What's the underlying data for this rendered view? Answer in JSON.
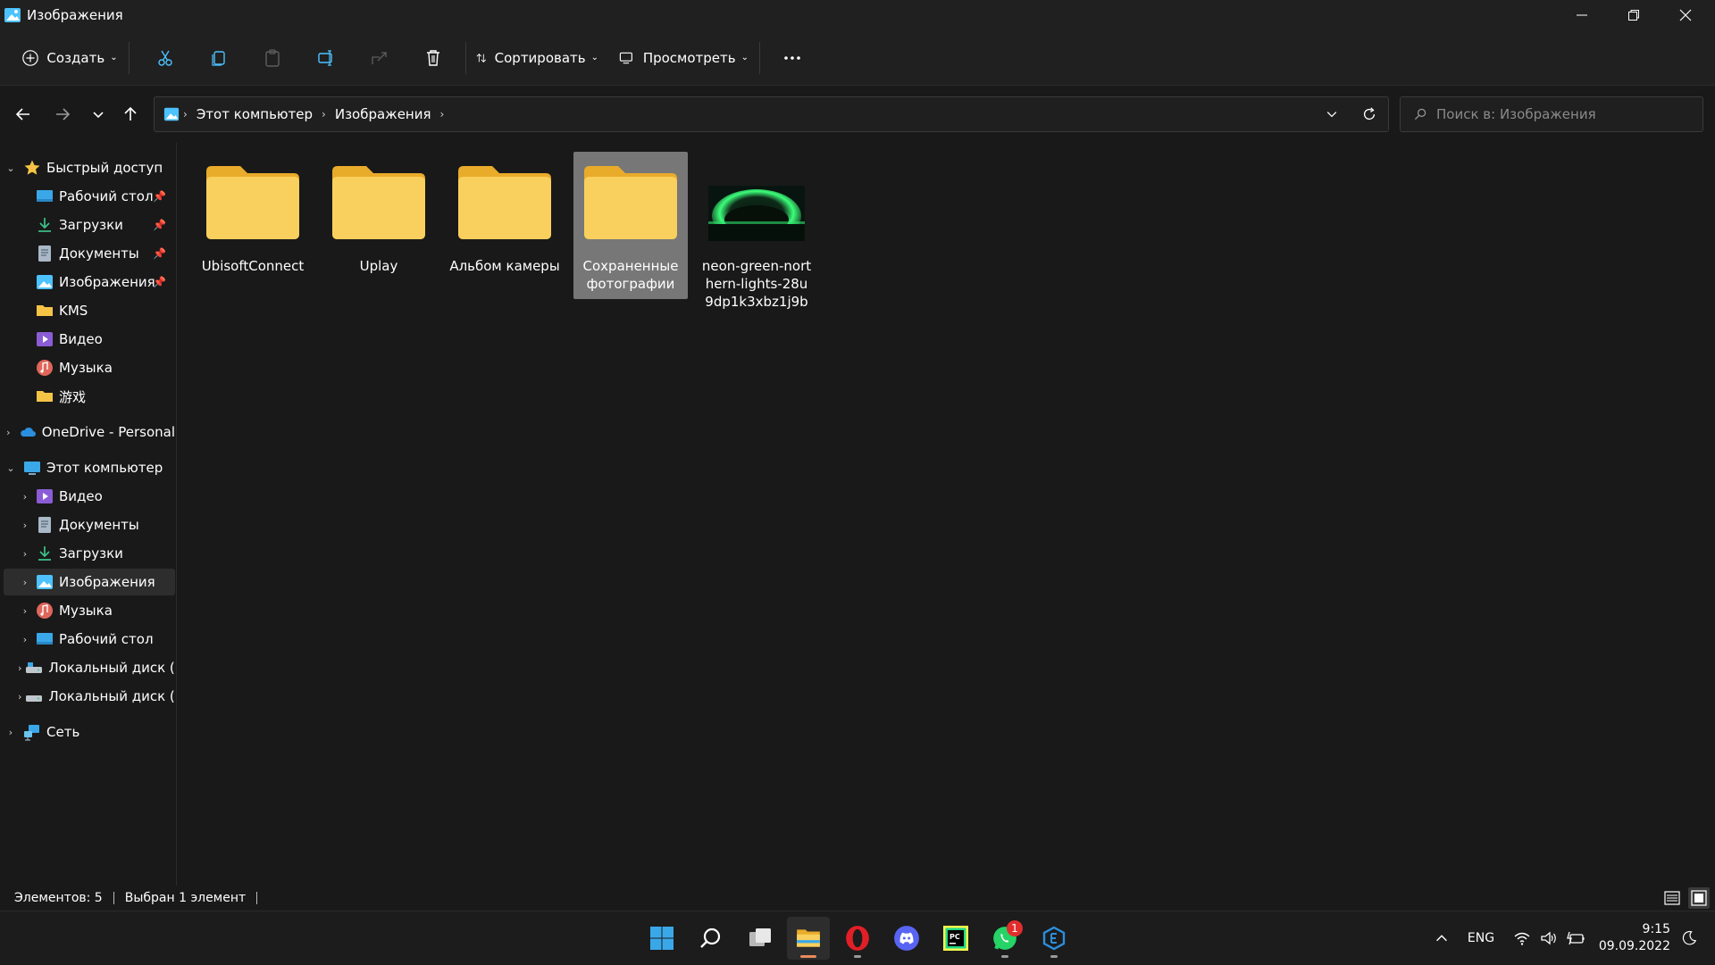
{
  "window": {
    "title": "Изображения"
  },
  "toolbar": {
    "create_label": "Создать",
    "sort_label": "Сортировать",
    "view_label": "Просмотреть"
  },
  "address": {
    "crumbs": [
      "Этот компьютер",
      "Изображения"
    ]
  },
  "search": {
    "placeholder": "Поиск в: Изображения"
  },
  "sidebar": {
    "quick_access": "Быстрый доступ",
    "quick_items": [
      "Рабочий стол",
      "Загрузки",
      "Документы",
      "Изображения",
      "KMS",
      "Видео",
      "Музыка",
      "游戏"
    ],
    "onedrive": "OneDrive - Personal",
    "this_pc": "Этот компьютер",
    "pc_items": [
      "Видео",
      "Документы",
      "Загрузки",
      "Изображения",
      "Музыка",
      "Рабочий стол",
      "Локальный диск (C",
      "Локальный диск (D"
    ],
    "network": "Сеть"
  },
  "files": [
    {
      "name": "UbisoftConnect",
      "type": "folder"
    },
    {
      "name": "Uplay",
      "type": "folder"
    },
    {
      "name": "Альбом камеры",
      "type": "folder"
    },
    {
      "name": "Сохраненные фотографии",
      "type": "folder",
      "selected": true
    },
    {
      "name": "neon-green-northern-lights-28u9dp1k3xbz1j9b",
      "type": "image"
    }
  ],
  "status": {
    "count": "Элементов: 5",
    "selection": "Выбран 1 элемент"
  },
  "taskbar": {
    "lang": "ENG",
    "time": "9:15",
    "date": "09.09.2022",
    "whatsapp_badge": "1"
  },
  "colors": {
    "folder": "#f6c445",
    "selection": "#777777",
    "accent": "#4cc2ff"
  }
}
